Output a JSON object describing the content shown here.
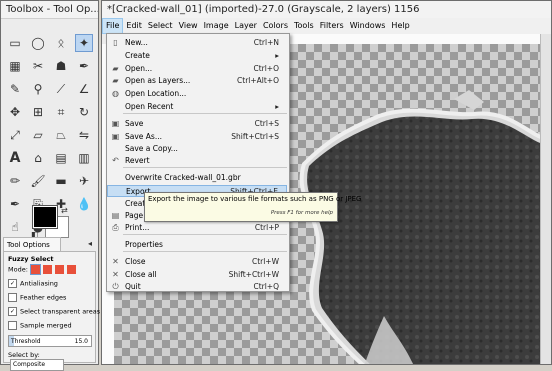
{
  "toolbox": {
    "title": "Toolbox - Tool Op...",
    "tool_options_tab": "Tool Options",
    "tool_name": "Fuzzy Select",
    "mode_label": "Mode:",
    "antialiasing": "Antialiasing",
    "feather_edges": "Feather edges",
    "select_transparent": "Select transparent areas",
    "sample_merged": "Sample merged",
    "threshold_label": "Threshold",
    "threshold_value": "15.0",
    "threshold_fraction": 0.06,
    "select_by_label": "Select by:",
    "select_by_value": "Composite",
    "colors": {
      "fg": "#000000",
      "bg": "#ffffff",
      "active_tool": "#bcd6f2"
    }
  },
  "main": {
    "title": "*[Cracked-wall_01] (imported)-27.0 (Grayscale, 2 layers) 1156",
    "menubar": [
      "File",
      "Edit",
      "Select",
      "View",
      "Image",
      "Layer",
      "Colors",
      "Tools",
      "Filters",
      "Windows",
      "Help"
    ],
    "menubar_open": "File"
  },
  "file_menu": {
    "items": [
      {
        "label": "New...",
        "shortcut": "Ctrl+N",
        "icon": "new-file-icon"
      },
      {
        "label": "Create",
        "shortcut": "▸",
        "icon": ""
      },
      {
        "label": "Open...",
        "shortcut": "Ctrl+O",
        "icon": "open-folder-icon"
      },
      {
        "label": "Open as Layers...",
        "shortcut": "Ctrl+Alt+O",
        "icon": "open-layers-icon"
      },
      {
        "label": "Open Location...",
        "shortcut": "",
        "icon": "globe-icon"
      },
      {
        "label": "Open Recent",
        "shortcut": "▸",
        "icon": ""
      },
      {
        "label": "Save",
        "shortcut": "Ctrl+S",
        "icon": "save-icon"
      },
      {
        "label": "Save As...",
        "shortcut": "Shift+Ctrl+S",
        "icon": "save-as-icon"
      },
      {
        "label": "Save a Copy...",
        "shortcut": "",
        "icon": ""
      },
      {
        "label": "Revert",
        "shortcut": "",
        "icon": "revert-icon"
      },
      {
        "label": "Overwrite Cracked-wall_01.gbr",
        "shortcut": "",
        "icon": ""
      },
      {
        "label": "Export...",
        "shortcut": "Shift+Ctrl+E",
        "icon": ""
      },
      {
        "label": "Create",
        "shortcut": "",
        "icon": ""
      },
      {
        "label": "Page S",
        "shortcut": "",
        "icon": "page-setup-icon"
      },
      {
        "label": "Print...",
        "shortcut": "Ctrl+P",
        "icon": "print-icon"
      },
      {
        "label": "Properties",
        "shortcut": "",
        "icon": ""
      },
      {
        "label": "Close",
        "shortcut": "Ctrl+W",
        "icon": "close-icon"
      },
      {
        "label": "Close all",
        "shortcut": "Shift+Ctrl+W",
        "icon": "close-all-icon"
      },
      {
        "label": "Quit",
        "shortcut": "Ctrl+Q",
        "icon": "quit-icon"
      }
    ],
    "highlighted_index": 11
  },
  "tooltip": {
    "text": "Export the image to various file formats such as PNG or JPEG",
    "hint": "Press F1 for more help"
  }
}
